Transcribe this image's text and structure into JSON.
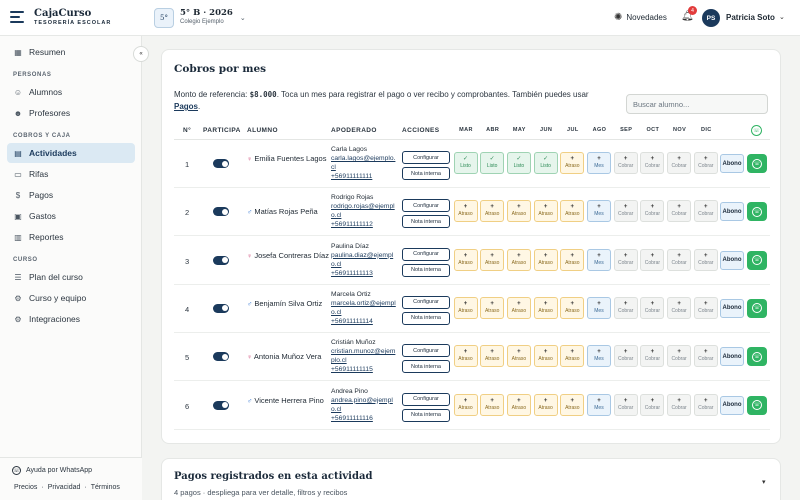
{
  "app": {
    "name": "CajaCurso",
    "subtitle": "TESORERÍA ESCOLAR"
  },
  "course": {
    "badge": "5°",
    "title": "5° B · 2026",
    "school": "Colegio Ejemplo"
  },
  "header": {
    "news_label": "Novedades",
    "notif_count": "4",
    "user_initials": "PS",
    "user_name": "Patricia Soto"
  },
  "sidebar": {
    "collapse": "«",
    "top": [
      {
        "label": "Resumen",
        "icon": "▦"
      }
    ],
    "section_personas": "PERSONAS",
    "personas": [
      {
        "label": "Alumnos",
        "icon": "☺"
      },
      {
        "label": "Profesores",
        "icon": "☻"
      }
    ],
    "section_cobros": "COBROS Y CAJA",
    "cobros": [
      {
        "label": "Actividades",
        "icon": "▤"
      },
      {
        "label": "Rifas",
        "icon": "▭"
      },
      {
        "label": "Pagos",
        "icon": "$"
      },
      {
        "label": "Gastos",
        "icon": "▣"
      },
      {
        "label": "Reportes",
        "icon": "▥"
      }
    ],
    "section_curso": "CURSO",
    "curso": [
      {
        "label": "Plan del curso",
        "icon": "☰"
      },
      {
        "label": "Curso y equipo",
        "icon": "⚙"
      },
      {
        "label": "Integraciones",
        "icon": "⚙"
      }
    ],
    "help": "Ayuda por WhatsApp",
    "links": [
      "Precios",
      "·",
      "Privacidad",
      "·",
      "Términos"
    ]
  },
  "main": {
    "title": "Cobros por mes",
    "ref_prefix": "Monto de referencia:",
    "ref_amount": "$8.000",
    "ref_suffix": ". Toca un mes para registrar el pago o ver recibo y comprobantes. También puedes usar",
    "ref_link": "Pagos",
    "ref_end": ".",
    "search_placeholder": "Buscar alumno...",
    "columns": {
      "n": "N°",
      "participa": "PARTICIPA",
      "alumno": "ALUMNO",
      "apoderado": "APODERADO",
      "acciones": "ACCIONES"
    },
    "months": [
      "MAR",
      "ABR",
      "MAY",
      "JUN",
      "JUL",
      "AGO",
      "SEP",
      "OCT",
      "NOV",
      "DIC"
    ],
    "btn_configurar": "Configurar",
    "btn_nota": "Nota interna",
    "btn_abono": "Abono",
    "rows": [
      {
        "n": "1",
        "participa": true,
        "gender": "f",
        "name": "Emilia Fuentes Lagos",
        "guardian": "Carla Lagos",
        "email": "carla.lagos@ejemplo.cl",
        "phone": "+56911111111",
        "months": [
          [
            "✓",
            "Listo"
          ],
          [
            "✓",
            "Listo"
          ],
          [
            "✓",
            "Listo"
          ],
          [
            "✓",
            "Listo"
          ],
          [
            "+",
            "Atraso"
          ],
          [
            "+",
            "Mes"
          ],
          [
            "+",
            "Cobrar"
          ],
          [
            "+",
            "Cobrar"
          ],
          [
            "+",
            "Cobrar"
          ],
          [
            "+",
            "Cobrar"
          ]
        ]
      },
      {
        "n": "2",
        "participa": true,
        "gender": "m",
        "name": "Matías Rojas Peña",
        "guardian": "Rodrigo Rojas",
        "email": "rodrigo.rojas@ejemplo.cl",
        "phone": "+56911111112",
        "months": [
          [
            "+",
            "Atraso"
          ],
          [
            "+",
            "Atraso"
          ],
          [
            "+",
            "Atraso"
          ],
          [
            "+",
            "Atraso"
          ],
          [
            "+",
            "Atraso"
          ],
          [
            "+",
            "Mes"
          ],
          [
            "+",
            "Cobrar"
          ],
          [
            "+",
            "Cobrar"
          ],
          [
            "+",
            "Cobrar"
          ],
          [
            "+",
            "Cobrar"
          ]
        ]
      },
      {
        "n": "3",
        "participa": true,
        "gender": "f",
        "name": "Josefa Contreras Díaz",
        "guardian": "Paulina Díaz",
        "email": "paulina.diaz@ejemplo.cl",
        "phone": "+56911111113",
        "months": [
          [
            "+",
            "Atraso"
          ],
          [
            "+",
            "Atraso"
          ],
          [
            "+",
            "Atraso"
          ],
          [
            "+",
            "Atraso"
          ],
          [
            "+",
            "Atraso"
          ],
          [
            "+",
            "Mes"
          ],
          [
            "+",
            "Cobrar"
          ],
          [
            "+",
            "Cobrar"
          ],
          [
            "+",
            "Cobrar"
          ],
          [
            "+",
            "Cobrar"
          ]
        ]
      },
      {
        "n": "4",
        "participa": true,
        "gender": "m",
        "name": "Benjamín Silva Ortiz",
        "guardian": "Marcela Ortiz",
        "email": "marcela.ortiz@ejemplo.cl",
        "phone": "+56911111114",
        "months": [
          [
            "+",
            "Atraso"
          ],
          [
            "+",
            "Atraso"
          ],
          [
            "+",
            "Atraso"
          ],
          [
            "+",
            "Atraso"
          ],
          [
            "+",
            "Atraso"
          ],
          [
            "+",
            "Mes"
          ],
          [
            "+",
            "Cobrar"
          ],
          [
            "+",
            "Cobrar"
          ],
          [
            "+",
            "Cobrar"
          ],
          [
            "+",
            "Cobrar"
          ]
        ]
      },
      {
        "n": "5",
        "participa": true,
        "gender": "f",
        "name": "Antonia Muñoz Vera",
        "guardian": "Cristián Muñoz",
        "email": "cristian.munoz@ejemplo.cl",
        "phone": "+56911111115",
        "months": [
          [
            "+",
            "Atraso"
          ],
          [
            "+",
            "Atraso"
          ],
          [
            "+",
            "Atraso"
          ],
          [
            "+",
            "Atraso"
          ],
          [
            "+",
            "Atraso"
          ],
          [
            "+",
            "Mes"
          ],
          [
            "+",
            "Cobrar"
          ],
          [
            "+",
            "Cobrar"
          ],
          [
            "+",
            "Cobrar"
          ],
          [
            "+",
            "Cobrar"
          ]
        ]
      },
      {
        "n": "6",
        "participa": true,
        "gender": "m",
        "name": "Vicente Herrera Pino",
        "guardian": "Andrea Pino",
        "email": "andrea.pino@ejemplo.cl",
        "phone": "+56911111116",
        "months": [
          [
            "+",
            "Atraso"
          ],
          [
            "+",
            "Atraso"
          ],
          [
            "+",
            "Atraso"
          ],
          [
            "+",
            "Atraso"
          ],
          [
            "+",
            "Atraso"
          ],
          [
            "+",
            "Mes"
          ],
          [
            "+",
            "Cobrar"
          ],
          [
            "+",
            "Cobrar"
          ],
          [
            "+",
            "Cobrar"
          ],
          [
            "+",
            "Cobrar"
          ]
        ]
      }
    ]
  },
  "payments": {
    "title": "Pagos registrados en esta actividad",
    "subtitle": "4 pagos · despliega para ver detalle, filtros y recibos",
    "chevron": "▾"
  },
  "colors": {
    "primary": "#1b3a5c",
    "whatsapp": "#2fb463",
    "listo": "#e6f5ec",
    "atraso": "#fff7e4",
    "mes": "#eaf3fb",
    "cobrar": "#f3f4f3",
    "active_nav": "#dbe9f3"
  }
}
